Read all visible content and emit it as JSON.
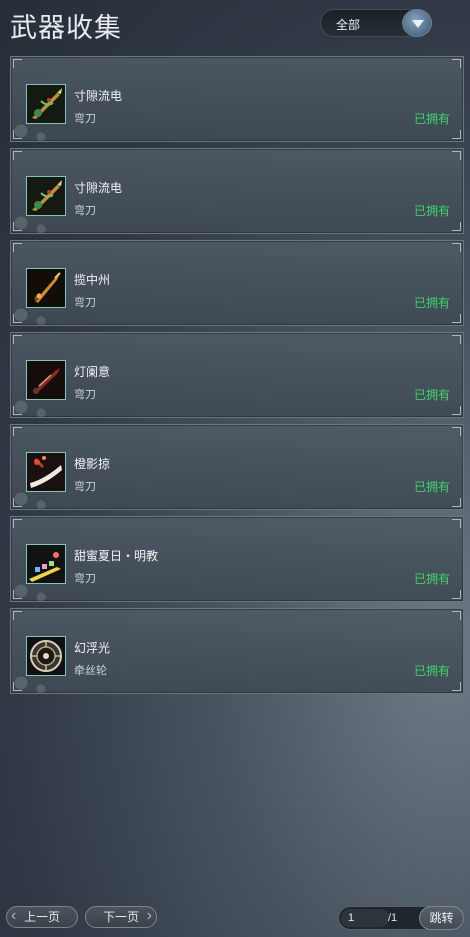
{
  "header": {
    "title": "武器收集"
  },
  "filter": {
    "selected": "全部"
  },
  "weapons": [
    {
      "name": "寸隙流电",
      "type": "弯刀",
      "status": "已拥有",
      "icon": "blade-green-gold-icon"
    },
    {
      "name": "寸隙流电",
      "type": "弯刀",
      "status": "已拥有",
      "icon": "blade-green-gold-icon"
    },
    {
      "name": "揽中州",
      "type": "弯刀",
      "status": "已拥有",
      "icon": "blade-golden-icon"
    },
    {
      "name": "灯阑意",
      "type": "弯刀",
      "status": "已拥有",
      "icon": "blade-crimson-icon"
    },
    {
      "name": "橙影掠",
      "type": "弯刀",
      "status": "已拥有",
      "icon": "blade-white-red-icon"
    },
    {
      "name": "甜蜜夏日・明教",
      "type": "弯刀",
      "status": "已拥有",
      "icon": "blade-candy-icon"
    },
    {
      "name": "幻浮光",
      "type": "牵丝轮",
      "status": "已拥有",
      "icon": "wheel-icon"
    }
  ],
  "pager": {
    "prev_label": "上一页",
    "next_label": "下一页",
    "current_page": "1",
    "total_pages": "/1",
    "jump_label": "跳转"
  }
}
